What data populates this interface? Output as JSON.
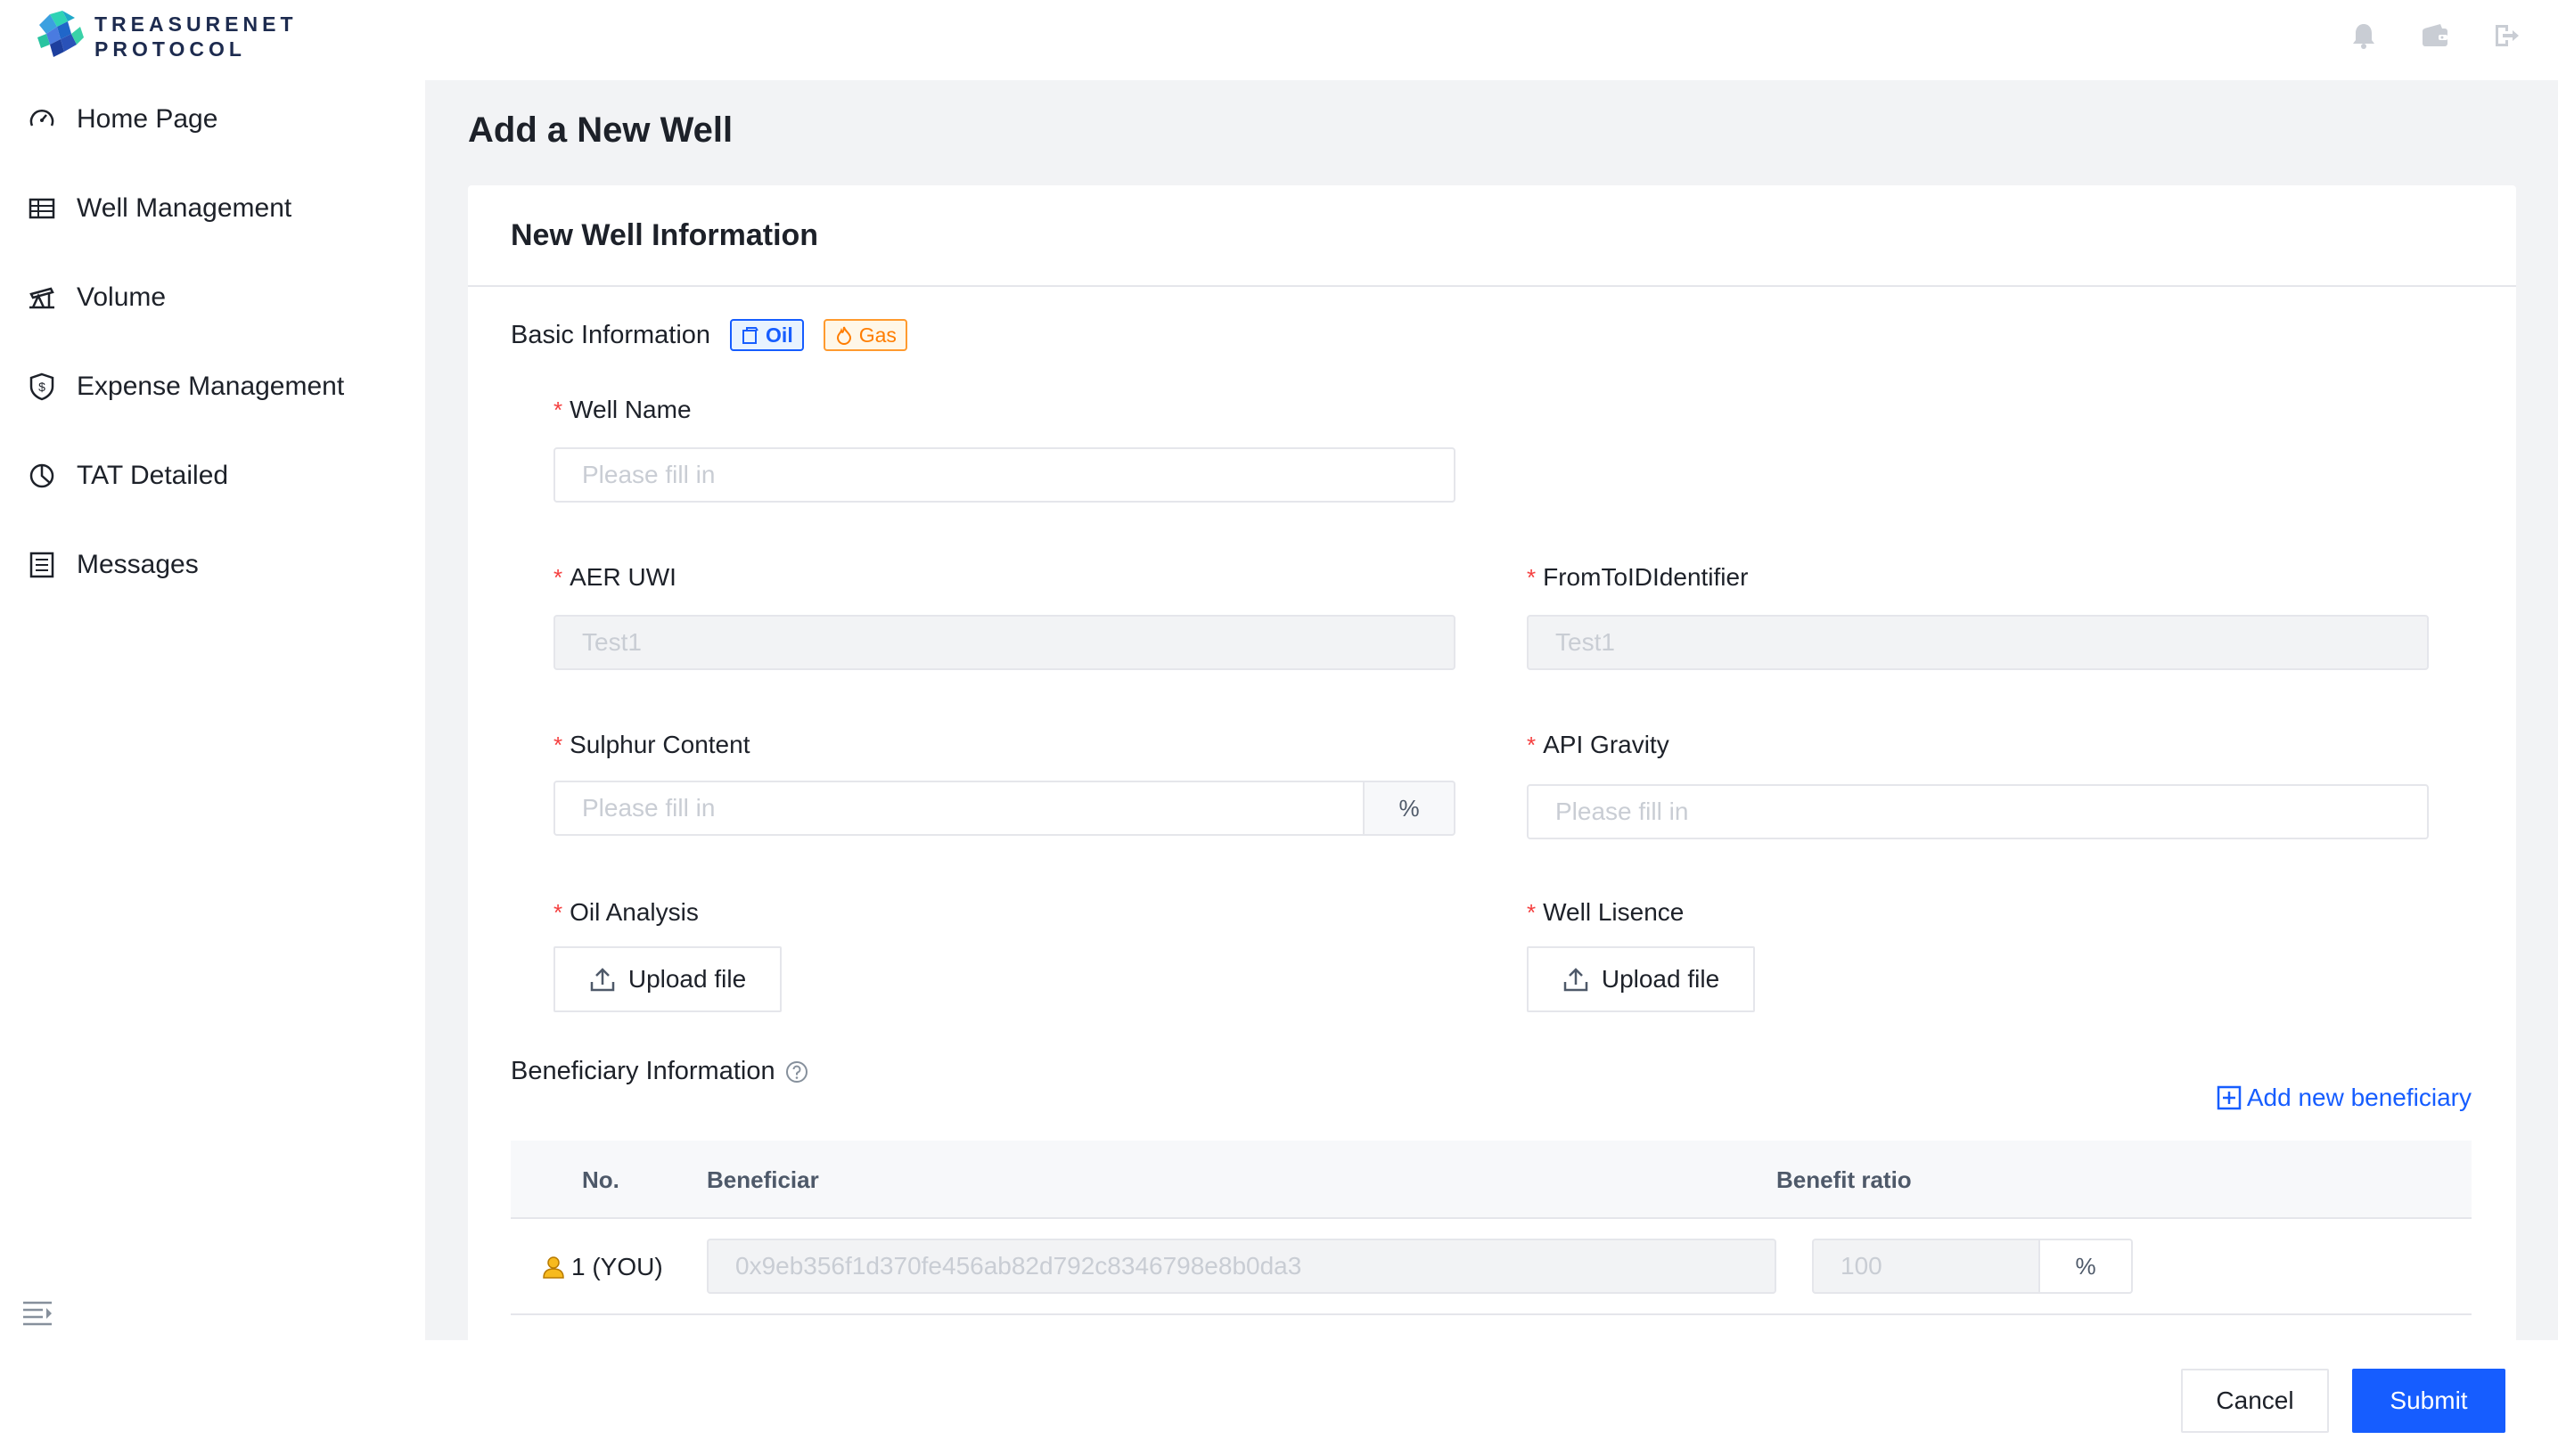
{
  "brand": {
    "line1": "TREASURENET",
    "line2": "PROTOCOL"
  },
  "sidebar": {
    "items": [
      {
        "label": "Home Page",
        "icon": "dashboard-icon"
      },
      {
        "label": "Well Management",
        "icon": "table-icon"
      },
      {
        "label": "Volume",
        "icon": "oil-pump-icon"
      },
      {
        "label": "Expense Management",
        "icon": "dollar-shield-icon"
      },
      {
        "label": "TAT Detailed",
        "icon": "pie-chart-icon"
      },
      {
        "label": "Messages",
        "icon": "list-icon"
      }
    ]
  },
  "page": {
    "title": "Add a New Well"
  },
  "card": {
    "title": "New Well Information"
  },
  "basic": {
    "title": "Basic Information",
    "tag_oil": "Oil",
    "tag_gas": "Gas"
  },
  "form": {
    "well_name": {
      "label": "Well Name",
      "placeholder": "Please fill in"
    },
    "aer_uwi": {
      "label": "AER UWI",
      "value": "Test1"
    },
    "from_to_id": {
      "label": "FromToIDIdentifier",
      "value": "Test1"
    },
    "sulphur": {
      "label": "Sulphur Content",
      "placeholder": "Please fill in",
      "suffix": "%"
    },
    "api_gravity": {
      "label": "API Gravity",
      "placeholder": "Please fill in"
    },
    "oil_analysis": {
      "label": "Oil Analysis",
      "button": "Upload file"
    },
    "well_licence": {
      "label": "Well Lisence",
      "button": "Upload file"
    }
  },
  "beneficiary": {
    "title": "Beneficiary Information",
    "add_label": "Add new beneficiary",
    "columns": [
      "No.",
      "Beneficiar",
      "Benefit ratio"
    ],
    "rows": [
      {
        "no": "1 (YOU)",
        "address": "0x9eb356f1d370fe456ab82d792c8346798e8b0da3",
        "ratio": "100",
        "suffix": "%"
      }
    ]
  },
  "footer": {
    "cancel": "Cancel",
    "submit": "Submit"
  },
  "colors": {
    "primary": "#165dff",
    "required": "#f53f3f",
    "gas": "#ff7d00"
  }
}
